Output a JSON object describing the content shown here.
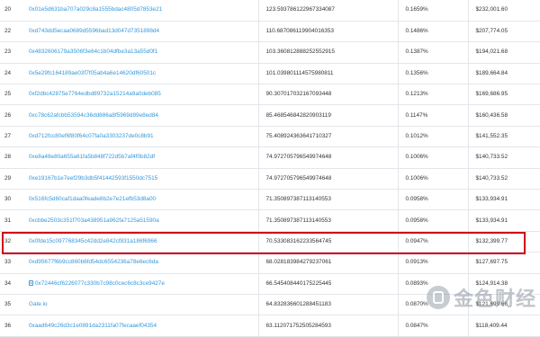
{
  "table": {
    "rows": [
      {
        "rank": "20",
        "address": "0x01e5d631ba707a029c8a1555bdac4805d7853e21",
        "quantity": "123.593786122967334087",
        "percentage": "0.1659%",
        "value": "$232,001.60"
      },
      {
        "rank": "22",
        "address": "0xd743dd5ecaa0689d5596bad13d047d7351898d4",
        "quantity": "110.687086119904016353",
        "percentage": "0.1486%",
        "value": "$207,774.05"
      },
      {
        "rank": "23",
        "address": "0x4832606179a3506f3e64c1b04dfbe3a13a55d0f1",
        "quantity": "103.360812888252552915",
        "percentage": "0.1387%",
        "value": "$194,021.68"
      },
      {
        "rank": "24",
        "address": "0x5e29fc164189ae03f7f05ab4a6e14620df60501c",
        "quantity": "101.039801114575980811",
        "percentage": "0.1356%",
        "value": "$189,664.84"
      },
      {
        "rank": "25",
        "address": "0xf2dbc42875e7764edbd89732a15214a9a0deb085",
        "quantity": "90.307017032167093448",
        "percentage": "0.1213%",
        "value": "$169,686.95"
      },
      {
        "rank": "26",
        "address": "0xc78c62afcbb53594c36dd886a8f5969d89e8ed84",
        "quantity": "85.468546842820903119",
        "percentage": "0.1147%",
        "value": "$160,436.58"
      },
      {
        "rank": "27",
        "address": "0xd712fcc80ef6f80f64c07fa0a3303237de0c8b91",
        "quantity": "75.408924363641710327",
        "percentage": "0.1012%",
        "value": "$141,552.35"
      },
      {
        "rank": "28",
        "address": "0xe8a48e80a655a61fa5b848f722d5b7af4f0b82df",
        "quantity": "74.972705796549974648",
        "percentage": "0.1006%",
        "value": "$140,733.52"
      },
      {
        "rank": "29",
        "address": "0xe19167b1e7eef29b3db5f41442593f1550dc7515",
        "quantity": "74.972705796549974648",
        "percentage": "0.1006%",
        "value": "$140,733.52"
      },
      {
        "rank": "30",
        "address": "0x516fc5d60caf1daa0feade8b2e7e21efb53d8a00",
        "quantity": "71.350897387113140553",
        "percentage": "0.0958%",
        "value": "$133,934.91"
      },
      {
        "rank": "31",
        "address": "0xcbbe2503c351f703a438951a962fa7125a51590a",
        "quantity": "71.350897387113140553",
        "percentage": "0.0958%",
        "value": "$133,934.91"
      },
      {
        "rank": "32",
        "address": "0x0fde15c097768345c42dd2e842cf831a186f6966",
        "quantity": "70.533083162233564745",
        "percentage": "0.0947%",
        "value": "$132,399.77"
      },
      {
        "rank": "33",
        "address": "0xd95677f6b9cc860b6fd54dc6554236a78e6ec6da",
        "quantity": "68.028183984279237061",
        "percentage": "0.0913%",
        "value": "$127,697.75"
      },
      {
        "rank": "34",
        "address": "0x72446cf6226077c330b7c98c0cec6c8c3ce9427e",
        "quantity": "66.545408440175225445",
        "percentage": "0.0893%",
        "value": "$124,914.38",
        "contract": true
      },
      {
        "rank": "35",
        "address": "Gate.io",
        "quantity": "64.832836601288451183",
        "percentage": "0.0870%",
        "value": "$121,699.66"
      },
      {
        "rank": "36",
        "address": "0xaad649c26d3c1e0891da2311fa07fecaaef04354",
        "quantity": "63.112071752505284593",
        "percentage": "0.0847%",
        "value": "$118,409.44"
      }
    ]
  },
  "highlight": {
    "rank": "33",
    "color": "#d0021b"
  },
  "colors": {
    "link": "#3498db",
    "text": "#333333",
    "border": "#e3e6ea"
  },
  "watermark": {
    "text": "金色财经"
  }
}
